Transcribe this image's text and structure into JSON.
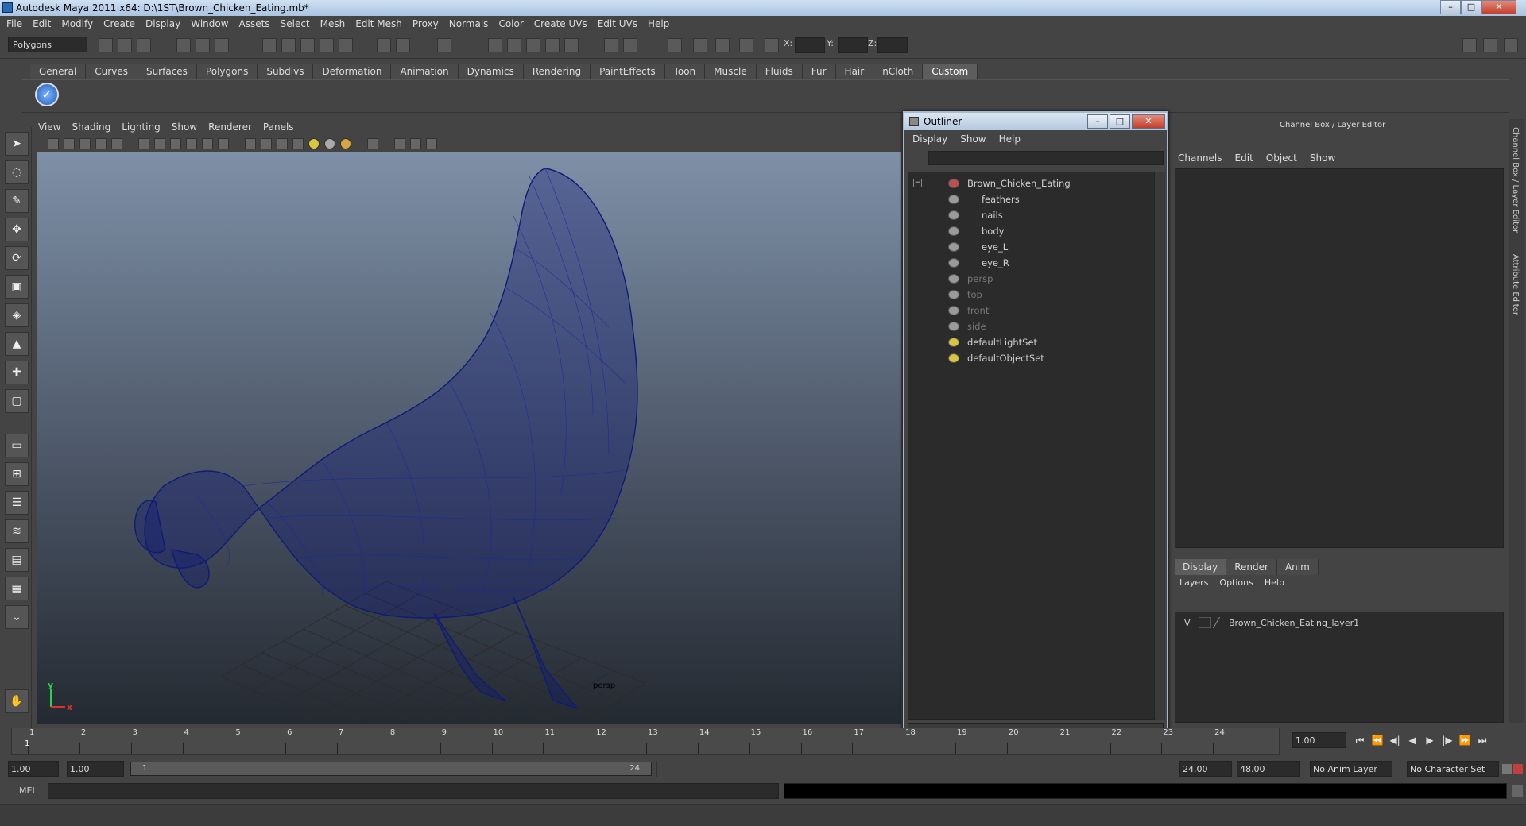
{
  "window": {
    "title": "Autodesk Maya 2011 x64: D:\\1ST\\Brown_Chicken_Eating.mb*",
    "min_glyph": "–",
    "max_glyph": "□",
    "close_glyph": "✕"
  },
  "menubar": [
    "File",
    "Edit",
    "Modify",
    "Create",
    "Display",
    "Window",
    "Assets",
    "Select",
    "Mesh",
    "Edit Mesh",
    "Proxy",
    "Normals",
    "Color",
    "Create UVs",
    "Edit UVs",
    "Help"
  ],
  "toolbar": {
    "mode_select": "Polygons",
    "x_label": "X:",
    "y_label": "Y:",
    "z_label": "Z:"
  },
  "shelf": {
    "tabs": [
      "General",
      "Curves",
      "Surfaces",
      "Polygons",
      "Subdivs",
      "Deformation",
      "Animation",
      "Dynamics",
      "Rendering",
      "PaintEffects",
      "Toon",
      "Muscle",
      "Fluids",
      "Fur",
      "Hair",
      "nCloth",
      "Custom"
    ],
    "active_tab": "Custom"
  },
  "viewport": {
    "menus": [
      "View",
      "Shading",
      "Lighting",
      "Show",
      "Renderer",
      "Panels"
    ],
    "camera_label": "persp",
    "axis_x": "x",
    "axis_y": "y",
    "wire_color": "#101a78"
  },
  "outliner": {
    "title": "Outliner",
    "menus": [
      "Display",
      "Show",
      "Help"
    ],
    "collapse_glyph": "−",
    "items": [
      {
        "label": "Brown_Chicken_Eating",
        "level": 0,
        "dim": false
      },
      {
        "label": "feathers",
        "level": 1,
        "dim": false
      },
      {
        "label": "nails",
        "level": 1,
        "dim": false
      },
      {
        "label": "body",
        "level": 1,
        "dim": false
      },
      {
        "label": "eye_L",
        "level": 1,
        "dim": false
      },
      {
        "label": "eye_R",
        "level": 1,
        "dim": false
      },
      {
        "label": "persp",
        "level": 0,
        "dim": true
      },
      {
        "label": "top",
        "level": 0,
        "dim": true
      },
      {
        "label": "front",
        "level": 0,
        "dim": true
      },
      {
        "label": "side",
        "level": 0,
        "dim": true
      },
      {
        "label": "defaultLightSet",
        "level": 0,
        "dim": false
      },
      {
        "label": "defaultObjectSet",
        "level": 0,
        "dim": false
      }
    ]
  },
  "channel_box": {
    "header": "Channel Box / Layer Editor",
    "menus": [
      "Channels",
      "Edit",
      "Object",
      "Show"
    ],
    "layer_tabs": [
      "Display",
      "Render",
      "Anim"
    ],
    "layer_menus": [
      "Layers",
      "Options",
      "Help"
    ],
    "layer_visibility": "V",
    "layer_name": "Brown_Chicken_Eating_layer1"
  },
  "side_tabs": [
    "Channel Box / Layer Editor",
    "Attribute Editor"
  ],
  "time_slider": {
    "frames": [
      "1",
      "2",
      "3",
      "4",
      "5",
      "6",
      "7",
      "8",
      "9",
      "10",
      "11",
      "12",
      "13",
      "14",
      "15",
      "16",
      "17",
      "18",
      "19",
      "20",
      "21",
      "22",
      "23",
      "24"
    ],
    "current_frame_label": "1",
    "current_frame": "1.00"
  },
  "range": {
    "start": "1.00",
    "playback_start": "1.00",
    "range_start_label": "1",
    "range_end_label": "24",
    "playback_end": "24.00",
    "end": "48.00",
    "anim_layer": "No Anim Layer",
    "character_set": "No Character Set"
  },
  "command_line": {
    "label": "MEL"
  },
  "colors": {
    "accent": "#5d5d5d",
    "wireframe": "#101a78",
    "background": "#444444"
  }
}
